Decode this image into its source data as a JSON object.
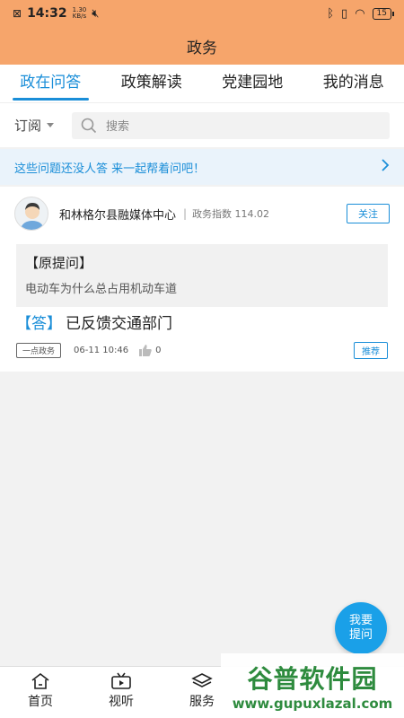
{
  "status_bar": {
    "time": "14:32",
    "speed_value": "1.30",
    "speed_unit": "KB/s",
    "battery": "15"
  },
  "title": "政务",
  "tabs": [
    "政在问答",
    "政策解读",
    "党建园地",
    "我的消息"
  ],
  "search": {
    "subscribe_label": "订阅",
    "placeholder": "搜索"
  },
  "banner": {
    "text": "这些问题还没人答 来一起帮着问吧！"
  },
  "post": {
    "org_name": "和林格尔县融媒体中心",
    "index_text": "政务指数 114.02",
    "follow_label": "关注",
    "question_title": "【原提问】",
    "question_text": "电动车为什么总占用机动车道",
    "answer_tag": "【答】",
    "answer_text": "已反馈交通部门",
    "source_tag": "一点政务",
    "date": "06-11 10:46",
    "likes": "0",
    "recommend_label": "推荐"
  },
  "fab": {
    "line1": "我要",
    "line2": "提问"
  },
  "bottom_nav": [
    {
      "label": "首页",
      "icon": "home-icon"
    },
    {
      "label": "视听",
      "icon": "video-icon"
    },
    {
      "label": "服务",
      "icon": "layers-icon"
    }
  ],
  "watermark": {
    "title": "谷普软件园",
    "url": "www.gupuxlazal.com"
  }
}
